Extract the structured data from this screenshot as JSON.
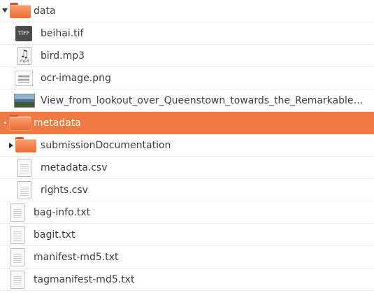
{
  "tree": {
    "rows": [
      {
        "name": "data",
        "kind": "folder",
        "expander": "expanded"
      },
      {
        "name": "beihai.tif",
        "kind": "tiff",
        "icon_text": "TIFF"
      },
      {
        "name": "bird.mp3",
        "kind": "audio",
        "icon_text": "mp3"
      },
      {
        "name": "ocr-image.png",
        "kind": "png"
      },
      {
        "name": "View_from_lookout_over_Queenstown_towards_the_Remarkable…",
        "kind": "photo"
      },
      {
        "name": "metadata",
        "kind": "folder",
        "selected": true
      },
      {
        "name": "submissionDocumentation",
        "kind": "folder",
        "expander": "collapsed"
      },
      {
        "name": "metadata.csv",
        "kind": "text"
      },
      {
        "name": "rights.csv",
        "kind": "text"
      },
      {
        "name": "bag-info.txt",
        "kind": "text"
      },
      {
        "name": "bagit.txt",
        "kind": "text"
      },
      {
        "name": "manifest-md5.txt",
        "kind": "text"
      },
      {
        "name": "tagmanifest-md5.txt",
        "kind": "text"
      }
    ],
    "accent_color": "#f07a43"
  }
}
